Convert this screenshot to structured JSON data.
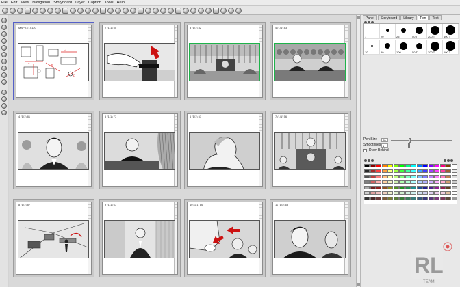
{
  "menu": [
    "File",
    "Edit",
    "View",
    "Navigation",
    "Storyboard",
    "Layer",
    "Caption",
    "Tools",
    "Help"
  ],
  "tabs": [
    "Panel",
    "Storyboard",
    "Library",
    "Pen",
    "Text"
  ],
  "active_tab": "Pen",
  "panels": [
    {
      "label": "MAP (1/1) 120",
      "scene": "map",
      "selected": true
    },
    {
      "label": "2 (1/1) 50",
      "scene": "hammer"
    },
    {
      "label": "3 (1/1) 82",
      "scene": "courtroom",
      "green": true
    },
    {
      "label": "4 (1/1) 83",
      "scene": "table",
      "green": true
    },
    {
      "label": "4 (1/1) 81",
      "scene": "closeup"
    },
    {
      "label": "5 (1/1) 77",
      "scene": "judge"
    },
    {
      "label": "6 (1/1) 53",
      "scene": "profile"
    },
    {
      "label": "7 (1/1) 56",
      "scene": "bench"
    },
    {
      "label": "8 (1/1) 87",
      "scene": "perspective"
    },
    {
      "label": "9 (1/1) 67",
      "scene": "standing"
    },
    {
      "label": "10 (1/1) 86",
      "scene": "arrows"
    },
    {
      "label": "11 (1/1) 63",
      "scene": "faces"
    }
  ],
  "pen_presets": [
    "1",
    "20",
    "25",
    "50 T",
    "200 T",
    "100 T",
    "10",
    "50",
    "100",
    "50 T",
    "200 T",
    "100 T"
  ],
  "pen_size_label": "Pen Size",
  "pen_size_value": "20",
  "smoothness_label": "Smoothness",
  "smoothness_value": "1",
  "draw_behind_label": "Draw Behind",
  "watermark": {
    "logo": "RL",
    "sub": "TEAM"
  },
  "colors": {
    "accent_selected": "#5560c8",
    "green_frame": "#1eb34a",
    "palette": [
      "#000000",
      "#8b0000",
      "#ff0000",
      "#ff8000",
      "#ffff00",
      "#80ff00",
      "#00ff00",
      "#00ff80",
      "#00ffff",
      "#0080ff",
      "#0000ff",
      "#8000ff",
      "#ff00ff",
      "#ff0080",
      "#804000",
      "#ffffff",
      "#2b2b2b",
      "#a52a2a",
      "#ff4040",
      "#ffa040",
      "#ffff80",
      "#a0ff40",
      "#40ff40",
      "#40ffa0",
      "#40ffff",
      "#40a0ff",
      "#4040ff",
      "#a040ff",
      "#ff40ff",
      "#ff40a0",
      "#a06030",
      "#eeeeee",
      "#555555",
      "#c04040",
      "#ff8080",
      "#ffc080",
      "#ffffb0",
      "#c0ff80",
      "#80ff80",
      "#80ffc0",
      "#80ffff",
      "#80c0ff",
      "#8080ff",
      "#c080ff",
      "#ff80ff",
      "#ff80c0",
      "#c08050",
      "#dddddd",
      "#808080",
      "#d06060",
      "#ffb0b0",
      "#ffd0a0",
      "#f0f0c0",
      "#d0f0b0",
      "#b0ffb0",
      "#b0ffd0",
      "#b0ffff",
      "#b0d0ff",
      "#b0b0ff",
      "#d0b0ff",
      "#ffb0ff",
      "#ffb0d0",
      "#d0a070",
      "#cccccc",
      "#aaaaaa",
      "#702020",
      "#902020",
      "#905020",
      "#909020",
      "#509020",
      "#209020",
      "#209050",
      "#209090",
      "#205090",
      "#202090",
      "#502090",
      "#902090",
      "#902050",
      "#604020",
      "#bbbbbb",
      "#cfcfcf",
      "#e0a0a0",
      "#f0c0c0",
      "#f0d0c0",
      "#f0f0d0",
      "#e0f0d0",
      "#d0f0d0",
      "#d0f0e0",
      "#d0f0f0",
      "#d0e0f0",
      "#d0d0f0",
      "#e0d0f0",
      "#f0d0f0",
      "#f0d0e0",
      "#e0c0a0",
      "#ffffff",
      "#333333",
      "#4a2a2a",
      "#6a3a3a",
      "#7a5a3a",
      "#7a7a3a",
      "#5a7a3a",
      "#3a7a3a",
      "#3a7a5a",
      "#3a7a7a",
      "#3a5a7a",
      "#3a3a7a",
      "#5a3a7a",
      "#7a3a7a",
      "#7a3a5a",
      "#5a4a3a",
      "#999999"
    ]
  }
}
